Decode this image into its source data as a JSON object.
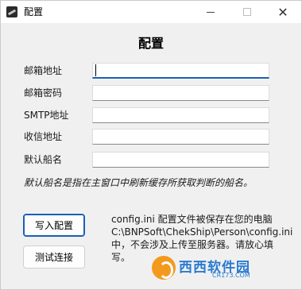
{
  "window": {
    "title": "配置",
    "minimize_icon": "minimize-icon",
    "maximize_icon": "maximize-icon",
    "close_icon": "close-icon",
    "close_glyph": "✕"
  },
  "form": {
    "heading": "配置",
    "fields": [
      {
        "label": "邮箱地址",
        "value": "",
        "placeholder": ""
      },
      {
        "label": "邮箱密码",
        "value": "",
        "placeholder": ""
      },
      {
        "label": "SMTP地址",
        "value": "",
        "placeholder": ""
      },
      {
        "label": "收信地址",
        "value": "",
        "placeholder": ""
      },
      {
        "label": "默认船名",
        "value": "",
        "placeholder": ""
      }
    ],
    "note": "默认船名是指在主窗口中刷新缓存所获取判断的船名。"
  },
  "actions": {
    "write_config": "写入配置",
    "test_connection": "测试连接"
  },
  "info": {
    "lines": [
      "config.ini 配置文件被保存在您的电脑",
      "C:\\BNPSoft\\ChekShip\\Person\\config.ini",
      "中，不会涉及上传至服务器。请放心填",
      "写。"
    ]
  },
  "watermark": {
    "text": "西西软件园",
    "url": "CR173.COM"
  },
  "colors": {
    "accent": "#1a5fb4",
    "window_bg": "#f0f0f0"
  }
}
